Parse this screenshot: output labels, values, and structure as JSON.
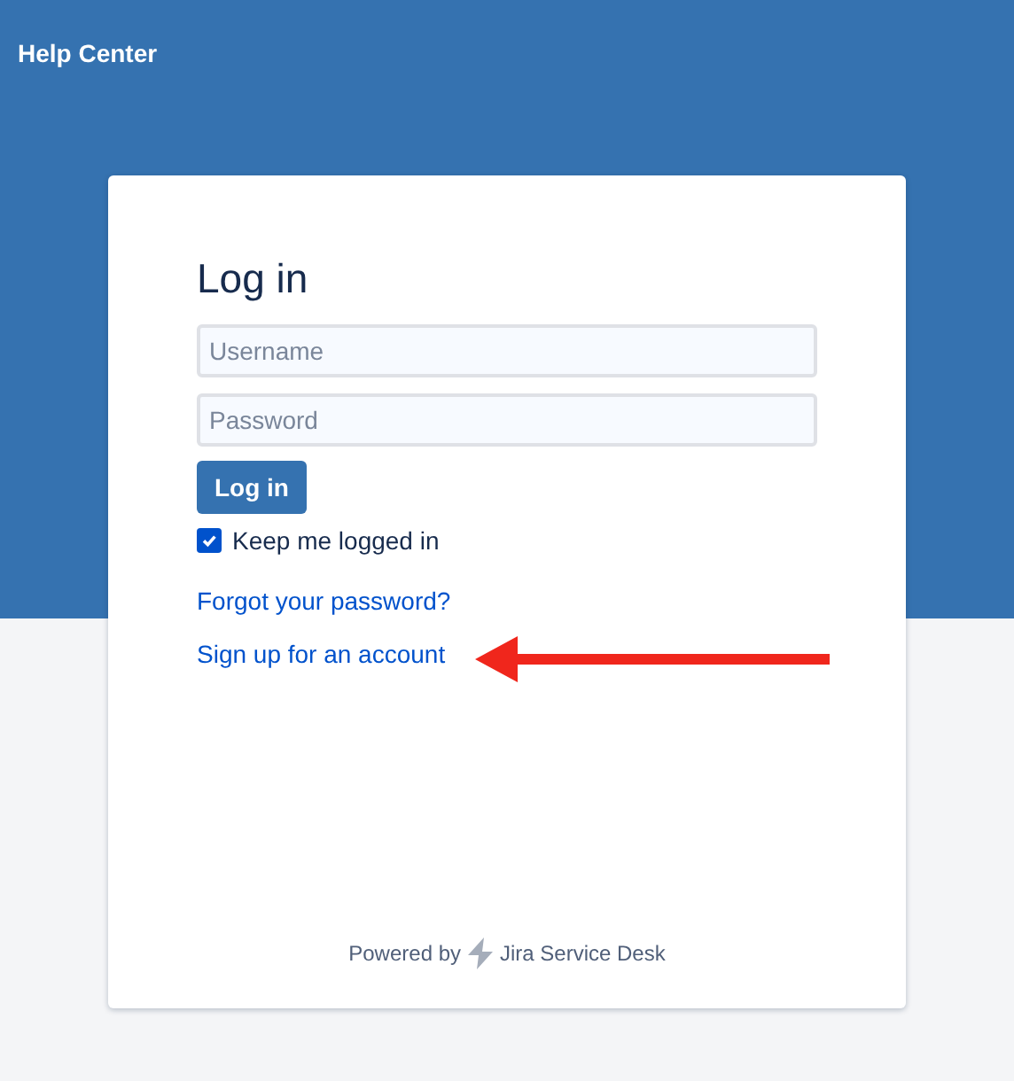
{
  "header": {
    "title": "Help Center"
  },
  "login": {
    "title": "Log in",
    "fields": [
      {
        "placeholder": "Username"
      },
      {
        "placeholder": "Password"
      }
    ],
    "button": "Log in",
    "remember": {
      "label": "Keep me logged in",
      "checked": true
    },
    "links": [
      "Forgot your password?",
      "Sign up for an account"
    ],
    "footer": {
      "prefix": "Powered by",
      "product": "Jira Service Desk"
    }
  }
}
